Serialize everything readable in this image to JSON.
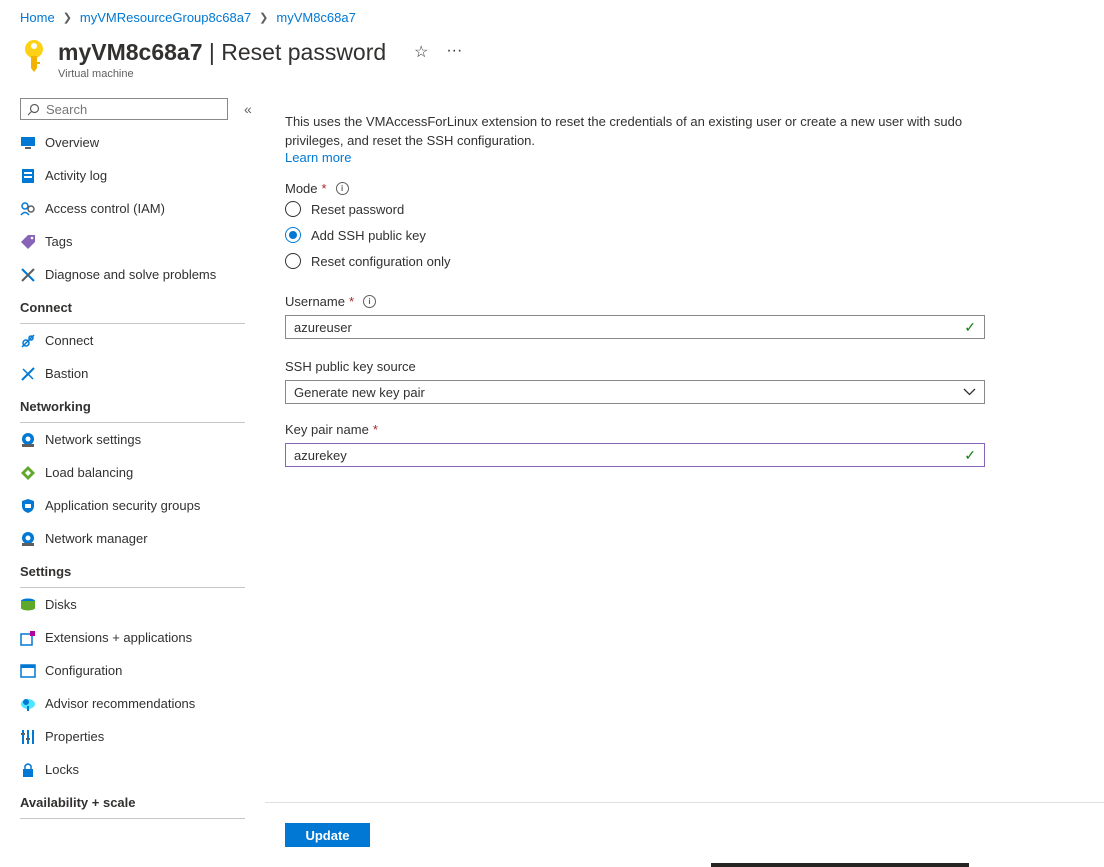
{
  "breadcrumb": [
    "Home",
    "myVMResourceGroup8c68a7",
    "myVM8c68a7"
  ],
  "header": {
    "vm_name": "myVM8c68a7",
    "separator": " | ",
    "page": "Reset password",
    "subtitle": "Virtual machine",
    "favorite_icon": "☆",
    "more_icon": "···"
  },
  "sidebar": {
    "search_placeholder": "Search",
    "collapse_icon": "«",
    "top_items": [
      "Overview",
      "Activity log",
      "Access control (IAM)",
      "Tags",
      "Diagnose and solve problems"
    ],
    "groups": {
      "connect": "Connect",
      "networking": "Networking",
      "settings": "Settings",
      "availability": "Availability + scale"
    },
    "connect_items": [
      "Connect",
      "Bastion"
    ],
    "networking_items": [
      "Network settings",
      "Load balancing",
      "Application security groups",
      "Network manager"
    ],
    "settings_items": [
      "Disks",
      "Extensions + applications",
      "Configuration",
      "Advisor recommendations",
      "Properties",
      "Locks"
    ]
  },
  "main": {
    "description": "This uses the VMAccessForLinux extension to reset the credentials of an existing user or create a new user with sudo privileges, and reset the SSH configuration.",
    "learn_more": "Learn more",
    "mode_label": "Mode",
    "required_mark": "*",
    "info_glyph": "i",
    "mode_options": [
      "Reset password",
      "Add SSH public key",
      "Reset configuration only"
    ],
    "mode_selected": "Add SSH public key",
    "username_label": "Username",
    "username_value": "azureuser",
    "ssh_source_label": "SSH public key source",
    "ssh_source_value": "Generate new key pair",
    "keypair_label": "Key pair name",
    "keypair_value": "azurekey",
    "valid_glyph": "✓",
    "chevron_glyph": "⌵"
  },
  "footer": {
    "update_label": "Update"
  },
  "colors": {
    "accent": "#0078d4",
    "required": "#a4262c",
    "valid": "#107c10",
    "focus": "#8764b8"
  }
}
